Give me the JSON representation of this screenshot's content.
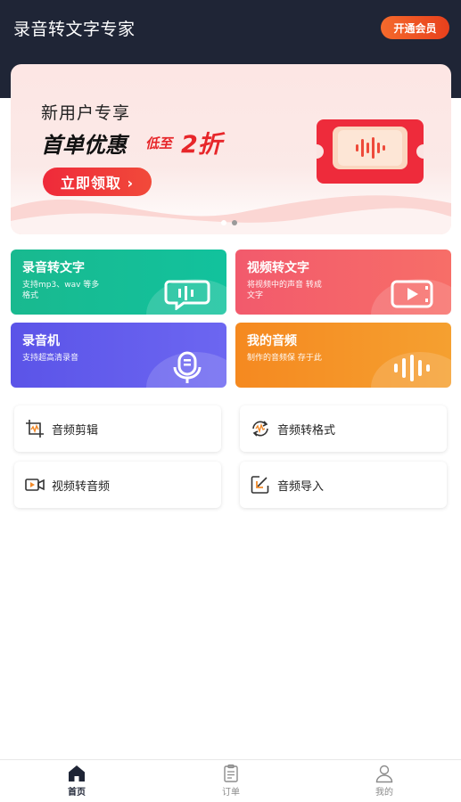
{
  "header": {
    "app_title": "录音转文字专家",
    "vip_button": "开通会员"
  },
  "banner": {
    "subtitle": "新用户专享",
    "main_text": "首单优惠",
    "low_text": "低至",
    "discount": "2折",
    "cta": "立即领取 ›",
    "slides": 2,
    "active_slide": 2
  },
  "feature_cards": [
    {
      "title": "录音转文字",
      "desc": "支持mp3、wav 等多格式",
      "icon": "speech-bubble-icon"
    },
    {
      "title": "视频转文字",
      "desc": "将视频中的声音 转成文字",
      "icon": "video-play-icon"
    },
    {
      "title": "录音机",
      "desc": "支持超高清录音",
      "icon": "microphone-icon"
    },
    {
      "title": "我的音频",
      "desc": "制作的音频保 存于此",
      "icon": "audio-bars-icon"
    }
  ],
  "tools": [
    {
      "label": "音频剪辑",
      "icon": "audio-crop-icon"
    },
    {
      "label": "音频转格式",
      "icon": "audio-convert-icon"
    },
    {
      "label": "视频转音频",
      "icon": "video-camera-icon"
    },
    {
      "label": "音频导入",
      "icon": "import-icon"
    }
  ],
  "tabbar": [
    {
      "label": "首页",
      "icon": "home-icon",
      "active": true
    },
    {
      "label": "订单",
      "icon": "order-icon",
      "active": false
    },
    {
      "label": "我的",
      "icon": "profile-icon",
      "active": false
    }
  ],
  "colors": {
    "header_bg": "#1f2536",
    "accent_red": "#e7262a",
    "card_green": "#12c29d",
    "card_red": "#f25a6c",
    "card_purple": "#5b54e8",
    "card_orange": "#f58920"
  }
}
